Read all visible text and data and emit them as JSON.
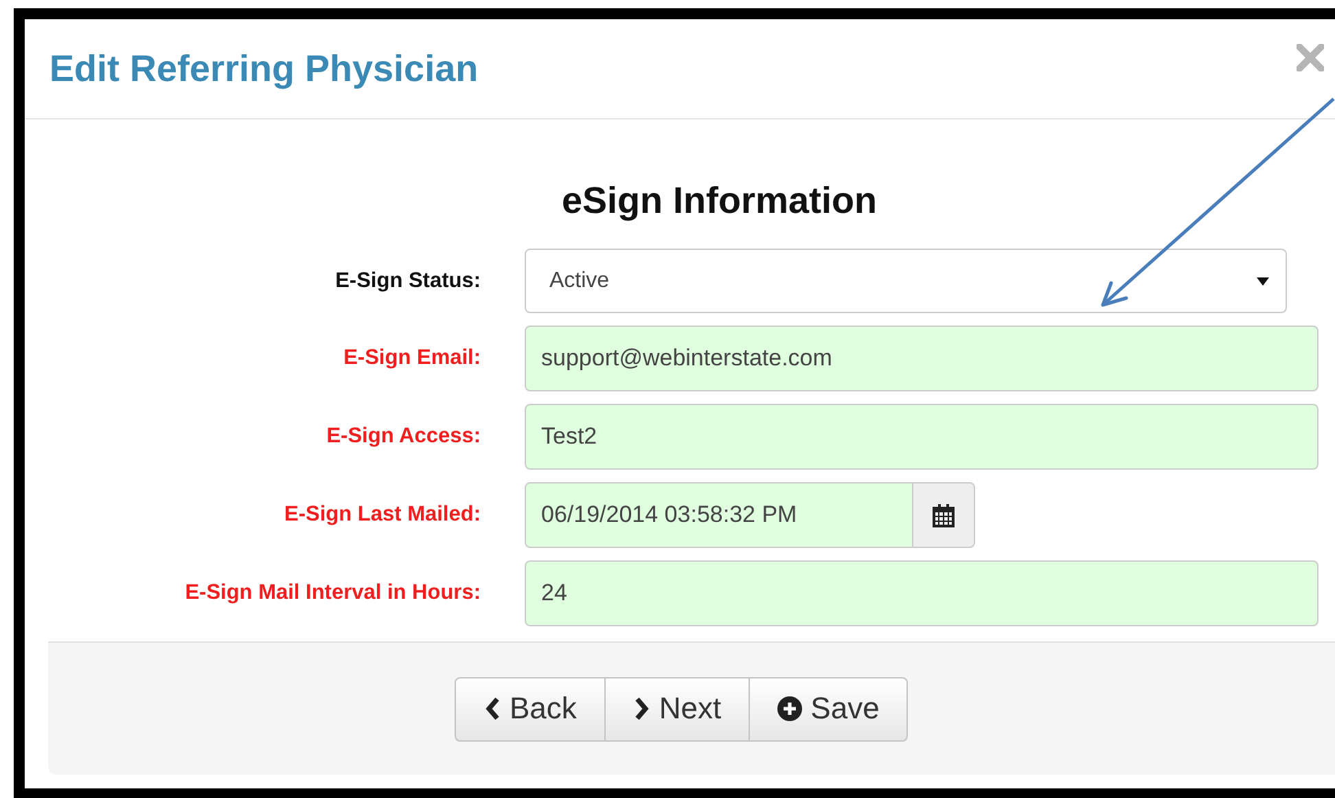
{
  "dialog": {
    "title": "Edit Referring Physician",
    "closable": true
  },
  "section": {
    "heading": "eSign Information"
  },
  "fields": [
    {
      "kind": "select",
      "label": "E-Sign Status:",
      "value": "Active",
      "required": false
    },
    {
      "kind": "text",
      "label": "E-Sign Email:",
      "value": "support@webinterstate.com",
      "required": true
    },
    {
      "kind": "text",
      "label": "E-Sign Access:",
      "value": "Test2",
      "required": true
    },
    {
      "kind": "date",
      "label": "E-Sign Last Mailed:",
      "value": "06/19/2014 03:58:32 PM",
      "required": true
    },
    {
      "kind": "text",
      "label": "E-Sign Mail Interval in Hours:",
      "value": "24",
      "required": true
    }
  ],
  "buttons": [
    {
      "kind": "back",
      "label": "Back"
    },
    {
      "kind": "next",
      "label": "Next"
    },
    {
      "kind": "save",
      "label": "Save"
    }
  ],
  "annotations": [
    {
      "kind": "arrow"
    }
  ]
}
